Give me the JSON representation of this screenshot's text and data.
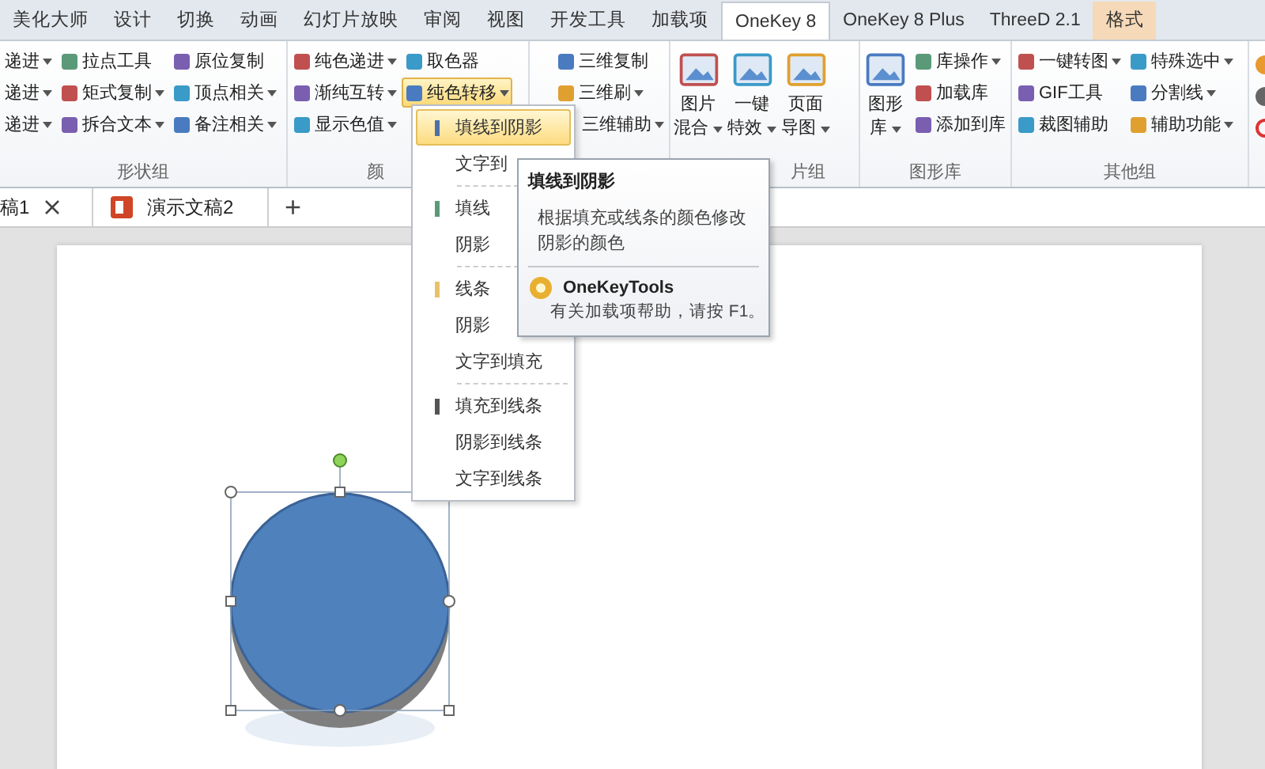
{
  "ribbon_tabs": [
    {
      "label": "美化大师",
      "selected": false,
      "contextual": false
    },
    {
      "label": "设计",
      "selected": false,
      "contextual": false
    },
    {
      "label": "切换",
      "selected": false,
      "contextual": false
    },
    {
      "label": "动画",
      "selected": false,
      "contextual": false
    },
    {
      "label": "幻灯片放映",
      "selected": false,
      "contextual": false
    },
    {
      "label": "审阅",
      "selected": false,
      "contextual": false
    },
    {
      "label": "视图",
      "selected": false,
      "contextual": false
    },
    {
      "label": "开发工具",
      "selected": false,
      "contextual": false
    },
    {
      "label": "加载项",
      "selected": false,
      "contextual": false
    },
    {
      "label": "OneKey 8",
      "selected": true,
      "contextual": false
    },
    {
      "label": "OneKey 8 Plus",
      "selected": false,
      "contextual": false
    },
    {
      "label": "ThreeD 2.1",
      "selected": false,
      "contextual": false
    },
    {
      "label": "格式",
      "selected": false,
      "contextual": true
    }
  ],
  "ribbon_groups": [
    {
      "label": "形状组",
      "columns": [
        [
          {
            "kind": "small",
            "label": "递进",
            "dropdown": true,
            "pressed": false
          },
          {
            "kind": "small",
            "label": "递进",
            "dropdown": true,
            "pressed": false
          },
          {
            "kind": "small",
            "label": "递进",
            "dropdown": true,
            "pressed": false
          }
        ],
        [
          {
            "kind": "small",
            "label": "拉点工具",
            "dropdown": false,
            "pressed": false
          },
          {
            "kind": "small",
            "label": "矩式复制",
            "dropdown": true,
            "pressed": false
          },
          {
            "kind": "small",
            "label": "拆合文本",
            "dropdown": true,
            "pressed": false
          }
        ],
        [
          {
            "kind": "small",
            "label": "原位复制",
            "dropdown": false,
            "pressed": false
          },
          {
            "kind": "small",
            "label": "顶点相关",
            "dropdown": true,
            "pressed": false
          },
          {
            "kind": "small",
            "label": "备注相关",
            "dropdown": true,
            "pressed": false
          }
        ]
      ]
    },
    {
      "label": "颜",
      "columns": [
        [
          {
            "kind": "small",
            "label": "纯色递进",
            "dropdown": true,
            "pressed": false
          },
          {
            "kind": "small",
            "label": "渐纯互转",
            "dropdown": true,
            "pressed": false
          },
          {
            "kind": "small",
            "label": "显示色值",
            "dropdown": true,
            "pressed": false
          }
        ],
        [
          {
            "kind": "small",
            "label": "取色器",
            "dropdown": false,
            "pressed": false
          },
          {
            "kind": "small",
            "label": "纯色转移",
            "dropdown": true,
            "pressed": true
          }
        ]
      ]
    },
    {
      "columns": [
        [
          {
            "kind": "small",
            "label": "三维复制",
            "dropdown": false,
            "pressed": false
          },
          {
            "kind": "small",
            "label": "三维刷",
            "dropdown": true,
            "pressed": false
          },
          {
            "kind": "small",
            "label": "三维辅助",
            "dropdown": true,
            "pressed": false
          }
        ]
      ]
    },
    {
      "label": "片组",
      "columns": [
        [
          {
            "kind": "large",
            "label": "图片",
            "label_2": "混合",
            "dropdown": true
          }
        ],
        [
          {
            "kind": "large",
            "label": "一键",
            "label_2": "特效",
            "dropdown": true
          }
        ],
        [
          {
            "kind": "large",
            "label": "页面",
            "label_2": "导图",
            "dropdown": true
          }
        ]
      ]
    },
    {
      "label": "图形库",
      "columns": [
        [
          {
            "kind": "large",
            "label": "图形",
            "label_2": "库",
            "dropdown": true
          }
        ],
        [
          {
            "kind": "small",
            "label": "库操作",
            "dropdown": true,
            "pressed": false
          },
          {
            "kind": "small",
            "label": "加载库",
            "dropdown": false,
            "pressed": false
          },
          {
            "kind": "small",
            "label": "添加到库",
            "dropdown": false,
            "pressed": false
          }
        ]
      ]
    },
    {
      "label": "其他组",
      "columns": [
        [
          {
            "kind": "small",
            "label": "一键转图",
            "dropdown": true,
            "pressed": false
          },
          {
            "kind": "small",
            "label": "GIF工具",
            "dropdown": false,
            "pressed": false
          },
          {
            "kind": "small",
            "label": "裁图辅助",
            "dropdown": false,
            "pressed": false
          }
        ],
        [
          {
            "kind": "small",
            "label": "特殊选中",
            "dropdown": true,
            "pressed": false
          },
          {
            "kind": "small",
            "label": "分割线",
            "dropdown": true,
            "pressed": false
          },
          {
            "kind": "small",
            "label": "辅助功能",
            "dropdown": true,
            "pressed": false
          }
        ]
      ]
    }
  ],
  "doc_tabs": [
    {
      "label": "稿1",
      "closable": true,
      "ppt_icon": false
    },
    {
      "label": "演示文稿2",
      "closable": false,
      "ppt_icon": true
    }
  ],
  "new_tab_button": "+",
  "menu": {
    "sections": [
      [
        {
          "label": "填线到阴影",
          "selected": true,
          "color": "#4f6fa8"
        },
        {
          "label": "文字到",
          "selected": false
        }
      ],
      [
        {
          "label": "填线",
          "selected": false,
          "color": "#5a9a78"
        },
        {
          "label": "阴影",
          "selected": false
        }
      ],
      [
        {
          "label": "线条",
          "selected": false,
          "color": "#e8c26a"
        },
        {
          "label": "阴影",
          "selected": false
        },
        {
          "label": "文字到填充",
          "selected": false
        }
      ],
      [
        {
          "label": "填充到线条",
          "selected": false,
          "color": "#555555"
        },
        {
          "label": "阴影到线条",
          "selected": false
        },
        {
          "label": "文字到线条",
          "selected": false
        }
      ]
    ]
  },
  "tooltip": {
    "title": "填线到阴影",
    "description": "根据填充或线条的颜色修改阴影的颜色",
    "footer_title": "OneKeyTools",
    "footer_text": "有关加载项帮助，请按 F1。"
  },
  "shape": {
    "selected": true
  }
}
